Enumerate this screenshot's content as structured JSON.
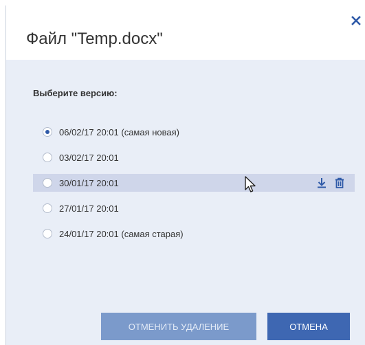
{
  "dialog": {
    "title": "Файл \"Temp.docx\"",
    "close_icon": "close-icon",
    "label": "Выберите версию:",
    "versions": [
      {
        "text": "06/02/17 20:01 (самая новая)",
        "selected": true
      },
      {
        "text": "03/02/17 20:01",
        "selected": false
      },
      {
        "text": "30/01/17 20:01",
        "selected": false,
        "hovered": true
      },
      {
        "text": "27/01/17 20:01",
        "selected": false
      },
      {
        "text": "24/01/17 20:01 (самая старая)",
        "selected": false
      }
    ],
    "row_actions": {
      "download_icon": "download-icon",
      "delete_icon": "trash-icon"
    },
    "buttons": {
      "undo_delete_label": "ОТМЕНИТЬ УДАЛЕНИЕ",
      "cancel_label": "ОТМЕНА"
    }
  },
  "colors": {
    "accent": "#3e67b2",
    "disabled": "#7b9acb",
    "panel": "#e9eef7",
    "hover_row": "#cfd6ea"
  }
}
